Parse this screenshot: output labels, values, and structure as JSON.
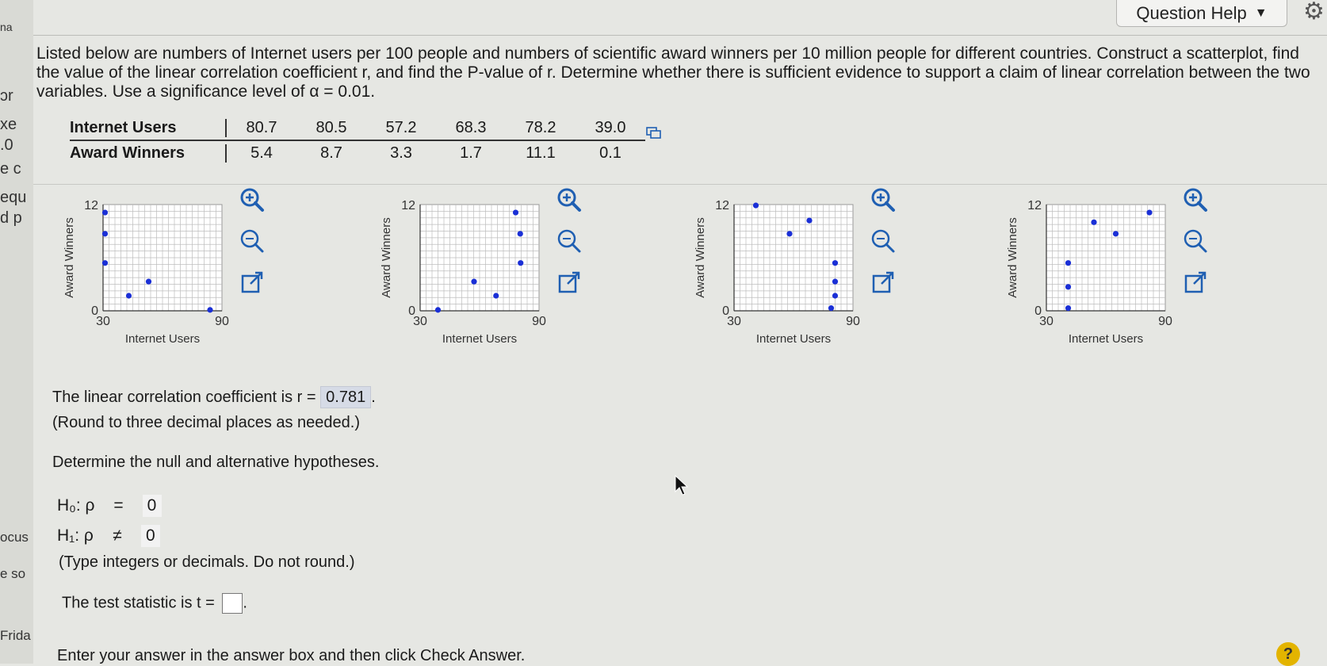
{
  "left_fragments": [
    "ɔr",
    "xe",
    ".0",
    "e c",
    "equ",
    "d p",
    "ocus",
    "e so",
    "Frida",
    "na"
  ],
  "question_help_label": "Question Help",
  "prompt": "Listed below are numbers of Internet users per 100 people and numbers of scientific award winners per 10 million people for different countries. Construct a scatterplot, find the value of the linear correlation coefficient r, and find the P-value of r. Determine whether there is sufficient evidence to support a claim of linear correlation between the two variables. Use a significance level of α = 0.01.",
  "table": {
    "row1_label": "Internet Users",
    "row2_label": "Award Winners",
    "internet_users": [
      "80.7",
      "80.5",
      "57.2",
      "68.3",
      "78.2",
      "39.0"
    ],
    "award_winners": [
      "5.4",
      "8.7",
      "3.3",
      "1.7",
      "11.1",
      "0.1"
    ]
  },
  "chart_data": [
    {
      "type": "scatter",
      "xlabel": "Internet Users",
      "ylabel": "Award Winners",
      "xlim": [
        30,
        90
      ],
      "ylim": [
        0,
        12
      ],
      "xticks": [
        "30",
        "90"
      ],
      "yticks": [
        "0",
        "12"
      ],
      "point_color": "#1a2fd6",
      "points": [
        [
          31,
          11.1
        ],
        [
          31,
          8.7
        ],
        [
          31,
          5.4
        ],
        [
          43,
          1.7
        ],
        [
          53,
          3.3
        ],
        [
          84,
          0.1
        ]
      ]
    },
    {
      "type": "scatter",
      "xlabel": "Internet Users",
      "ylabel": "Award Winners",
      "xlim": [
        30,
        90
      ],
      "ylim": [
        0,
        12
      ],
      "xticks": [
        "30",
        "90"
      ],
      "yticks": [
        "0",
        "12"
      ],
      "point_color": "#1a2fd6",
      "points": [
        [
          39.0,
          0.1
        ],
        [
          57.2,
          3.3
        ],
        [
          68.3,
          1.7
        ],
        [
          78.2,
          11.1
        ],
        [
          80.5,
          8.7
        ],
        [
          80.7,
          5.4
        ]
      ]
    },
    {
      "type": "scatter",
      "xlabel": "Internet Users",
      "ylabel": "Award Winners",
      "xlim": [
        30,
        90
      ],
      "ylim": [
        0,
        12
      ],
      "xticks": [
        "30",
        "90"
      ],
      "yticks": [
        "0",
        "12"
      ],
      "point_color": "#1a2fd6",
      "points": [
        [
          41,
          11.9
        ],
        [
          58,
          8.7
        ],
        [
          68,
          10.2
        ],
        [
          81,
          5.4
        ],
        [
          81,
          3.3
        ],
        [
          81,
          1.7
        ],
        [
          79,
          0.3
        ]
      ]
    },
    {
      "type": "scatter",
      "xlabel": "Internet Users",
      "ylabel": "Award Winners",
      "xlim": [
        30,
        90
      ],
      "ylim": [
        0,
        12
      ],
      "xticks": [
        "30",
        "90"
      ],
      "yticks": [
        "0",
        "12"
      ],
      "point_color": "#1a2fd6",
      "points": [
        [
          41,
          5.4
        ],
        [
          41,
          2.7
        ],
        [
          41,
          0.3
        ],
        [
          54,
          10.0
        ],
        [
          65,
          8.7
        ],
        [
          82,
          11.1
        ]
      ]
    }
  ],
  "answer": {
    "r_prefix": "The linear correlation coefficient is r =",
    "r_value": "0.781",
    "r_suffix": ".",
    "round_note": "(Round to three decimal places as needed.)",
    "hyp_prompt": "Determine the null and alternative hypotheses.",
    "h0_label": "H₀: ρ",
    "h0_symbol": "=",
    "h0_value": "0",
    "h1_label": "H₁: ρ",
    "h1_symbol": "≠",
    "h1_value": "0",
    "type_note": "(Type integers or decimals. Do not round.)",
    "t_prefix": "The test statistic is t =",
    "t_suffix": ".",
    "footer": "Enter your answer in the answer box and then click Check Answer."
  },
  "help_icon": "?"
}
